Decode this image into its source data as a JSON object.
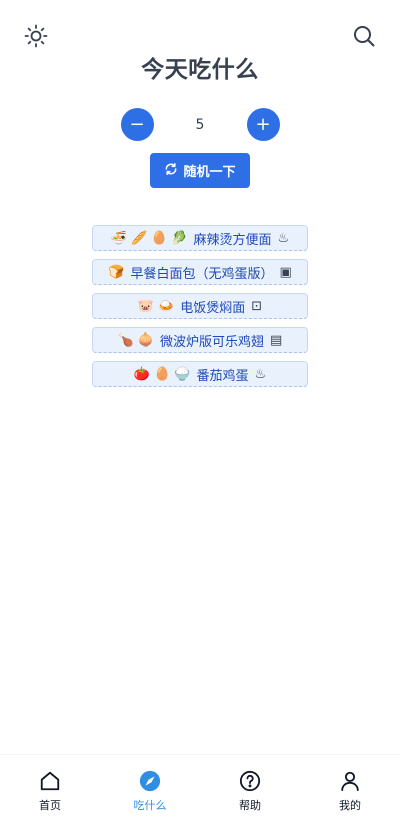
{
  "header": {
    "title": "今天吃什么",
    "left_icon": "sun-icon",
    "right_icon": "search-icon"
  },
  "stepper": {
    "minus_label": "−",
    "count": "5",
    "plus_label": "+"
  },
  "random_button": {
    "label": "随机一下",
    "icon": "refresh-icon"
  },
  "recipes": [
    {
      "ingredients": [
        "🍜",
        "🥖",
        "🥚",
        "🥬"
      ],
      "name": "麻辣烫方便面",
      "tool": "♨"
    },
    {
      "ingredients": [
        "🍞"
      ],
      "name": "早餐白面包（无鸡蛋版）",
      "tool": "▣"
    },
    {
      "ingredients": [
        "🐷",
        "🍛"
      ],
      "name": "电饭煲焖面",
      "tool": "⊡"
    },
    {
      "ingredients": [
        "🍗",
        "🧅"
      ],
      "name": "微波炉版可乐鸡翅",
      "tool": "▤"
    },
    {
      "ingredients": [
        "🍅",
        "🥚",
        "🍚"
      ],
      "name": "番茄鸡蛋",
      "tool": "♨"
    }
  ],
  "nav": [
    {
      "label": "首页",
      "icon": "home-icon",
      "active": false
    },
    {
      "label": "吃什么",
      "icon": "compass-icon",
      "active": true
    },
    {
      "label": "帮助",
      "icon": "help-icon",
      "active": false
    },
    {
      "label": "我的",
      "icon": "user-icon",
      "active": false
    }
  ],
  "colors": {
    "primary": "#2f6fe6",
    "recipe_bg": "#e9f1fd",
    "recipe_text": "#1e49b8",
    "nav_active": "#2f8de4"
  }
}
